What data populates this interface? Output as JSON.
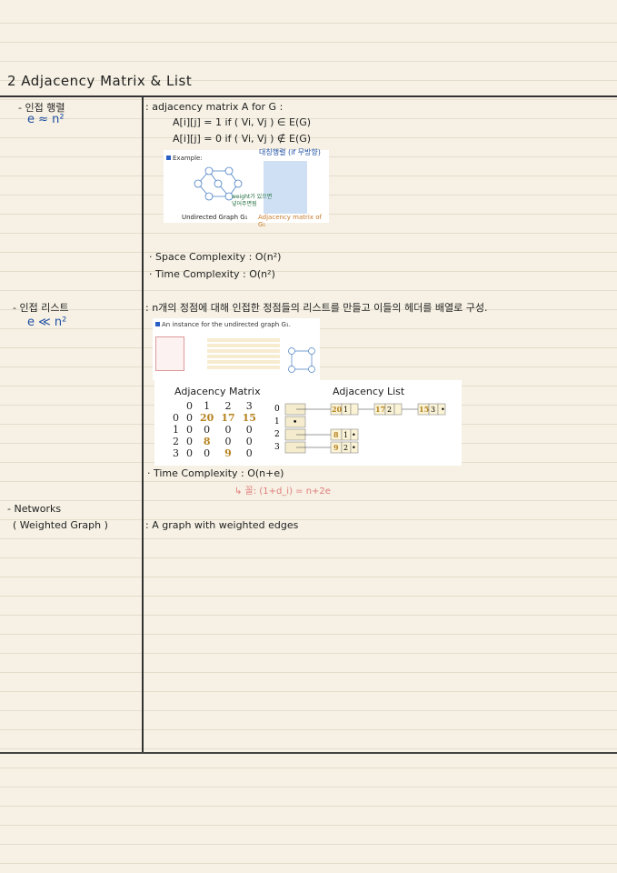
{
  "title": "2 Adjacency Matrix & List",
  "sections": {
    "matrix": {
      "heading": "- 인접 행렬",
      "note": "e ≈ n²",
      "def_line0": ": adjacency matrix  A for G :",
      "def_line1": "A[i][j] = 1   if ( Vi, Vj ) ∈ E(G)",
      "def_line2": "A[i][j] = 0   if ( Vi, Vj ) ∉ E(G)",
      "example_label": "Example:",
      "caption_left": "Undirected Graph G₁",
      "caption_right": "Adjacency matrix of G₁",
      "annot_symmetric": "대칭행렬 (if 무방향)",
      "annot_weight": "weight가 있으면 넣어주면됨",
      "space": "· Space Complexity  : O(n²)",
      "time": "· Time Complexity : O(n²)"
    },
    "list": {
      "heading": "- 인접 리스트",
      "note": "e ≪ n²",
      "desc": ": n개의 정점에 대해 인접한 정점들의 리스트를 만들고 이들의 헤더를 배열로 구성.",
      "instance_label": "An instance for the undirected graph G₁.",
      "time": "· Time Complexity : O(n+e)",
      "time_note": "↳ 꼴: (1+d_i) = n+2e"
    },
    "network": {
      "heading1": "- Networks",
      "heading2": "( Weighted Graph )",
      "desc": ": A graph with weighted edges"
    }
  },
  "matrix_figure": {
    "title": "Adjacency Matrix",
    "col_headers": [
      "0",
      "1",
      "2",
      "3"
    ],
    "rows": [
      {
        "label": "0",
        "values": [
          "0",
          "20",
          "17",
          "15"
        ]
      },
      {
        "label": "1",
        "values": [
          "0",
          "0",
          "0",
          "0"
        ]
      },
      {
        "label": "2",
        "values": [
          "0",
          "8",
          "0",
          "0"
        ]
      },
      {
        "label": "3",
        "values": [
          "0",
          "0",
          "9",
          "0"
        ]
      }
    ]
  },
  "list_figure": {
    "title": "Adjacency List",
    "rows": [
      {
        "label": "0",
        "nodes": [
          [
            "20",
            "1"
          ],
          [
            "17",
            "2"
          ],
          [
            "15",
            "3"
          ]
        ]
      },
      {
        "label": "1",
        "nodes": []
      },
      {
        "label": "2",
        "nodes": [
          [
            "8",
            "1"
          ]
        ]
      },
      {
        "label": "3",
        "nodes": [
          [
            "9",
            "2"
          ]
        ]
      }
    ],
    "null_mark": "•"
  }
}
